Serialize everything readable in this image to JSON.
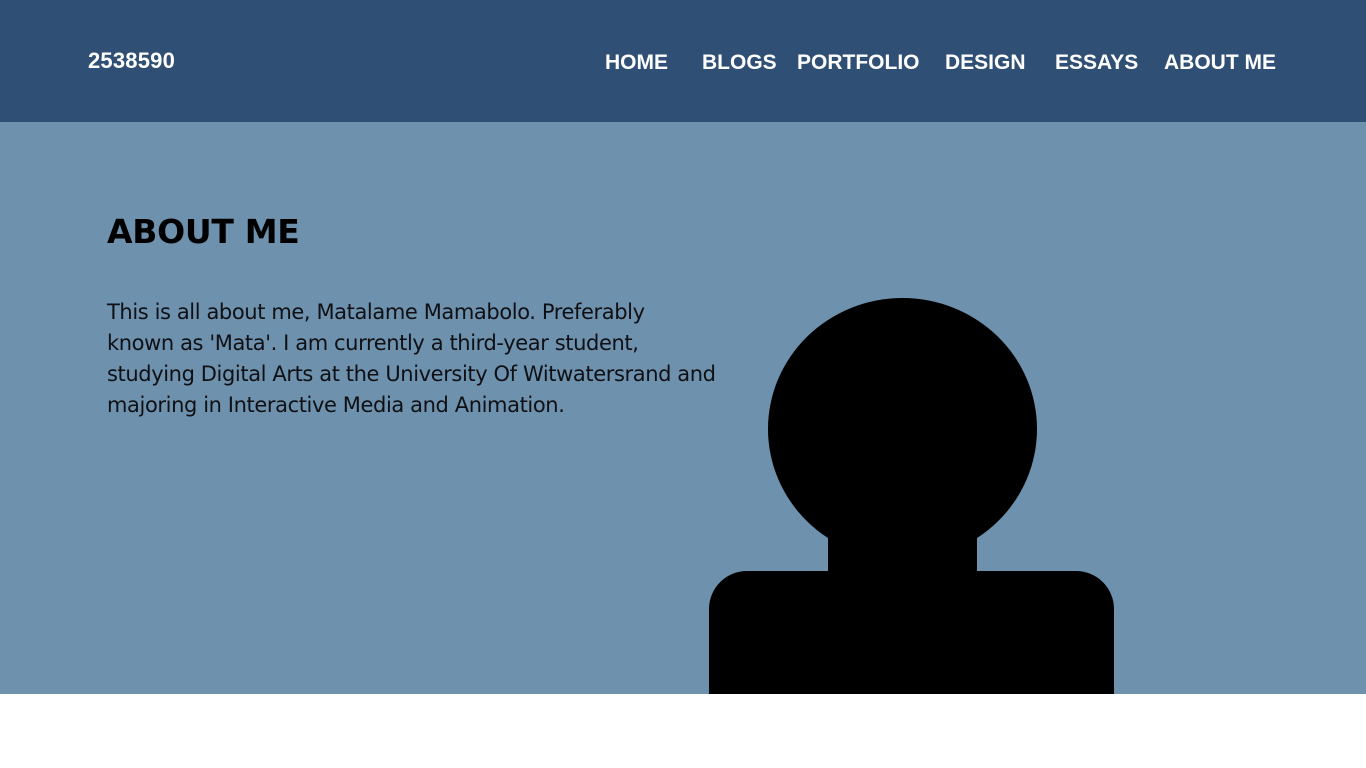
{
  "site": {
    "id_label": "2538590"
  },
  "nav": {
    "items": [
      {
        "label": "HOME"
      },
      {
        "label": "BLOGS"
      },
      {
        "label": "PORTFOLIO"
      },
      {
        "label": "DESIGN"
      },
      {
        "label": "ESSAYS"
      },
      {
        "label": "ABOUT ME"
      }
    ]
  },
  "about": {
    "title": "ABOUT ME",
    "body": "This is all about me, Matalame Mamabolo. Preferably known as 'Mata'. I am currently a third-year student, studying Digital Arts at the University Of Witwatersrand and majoring in Interactive Media and Animation.",
    "avatar_icon": "person-silhouette-icon"
  },
  "colors": {
    "header_bg": "#2f4f74",
    "hero_bg": "#6e91ae",
    "text_light": "#ffffff",
    "text_dark": "#000000"
  }
}
